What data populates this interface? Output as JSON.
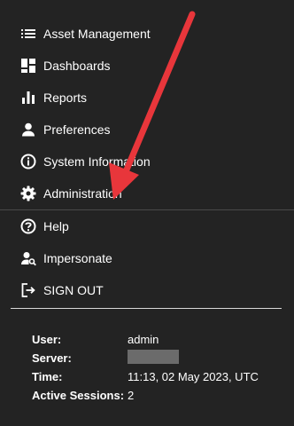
{
  "menu": {
    "items": [
      {
        "label": "Asset Management",
        "icon": "list-icon"
      },
      {
        "label": "Dashboards",
        "icon": "dashboard-icon"
      },
      {
        "label": "Reports",
        "icon": "bar-chart-icon"
      },
      {
        "label": "Preferences",
        "icon": "person-icon"
      },
      {
        "label": "System Information",
        "icon": "info-icon"
      },
      {
        "label": "Administration",
        "icon": "gear-icon"
      },
      {
        "label": "Help",
        "icon": "help-circle-icon"
      },
      {
        "label": "Impersonate",
        "icon": "person-search-icon"
      },
      {
        "label": "SIGN OUT",
        "icon": "sign-out-icon"
      }
    ]
  },
  "info": {
    "user_label": "User:",
    "user_value": "admin",
    "server_label": "Server:",
    "server_value": "",
    "time_label": "Time:",
    "time_value": "11:13, 02 May 2023, UTC",
    "sessions_label": "Active Sessions:",
    "sessions_value": "2"
  },
  "colors": {
    "background": "#232323",
    "arrow": "#e8363b"
  }
}
